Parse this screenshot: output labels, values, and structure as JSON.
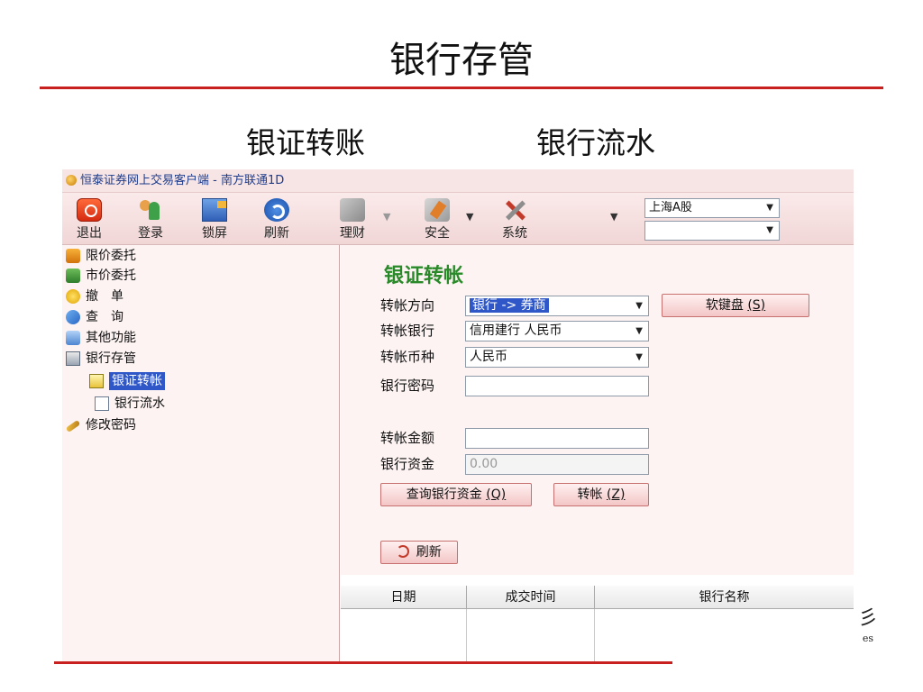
{
  "slide": {
    "title": "银行存管",
    "subtitle_left": "银证转账",
    "subtitle_right": "银行流水",
    "corner_glyph": "彡",
    "corner_text": "es"
  },
  "window": {
    "title": "恒泰证券网上交易客户端 - 南方联通1D"
  },
  "toolbar": {
    "exit": "退出",
    "login": "登录",
    "lock": "锁屏",
    "refresh": "刷新",
    "finance": "理财",
    "safety": "安全",
    "system": "系统",
    "market_select": "上海A股",
    "market_select2": ""
  },
  "sidebar": {
    "items": [
      {
        "label": "限价委托"
      },
      {
        "label": "市价委托"
      },
      {
        "label": "撤　单"
      },
      {
        "label": "查　询"
      },
      {
        "label": "其他功能"
      },
      {
        "label": "银行存管"
      },
      {
        "label": "银证转帐"
      },
      {
        "label": "银行流水"
      },
      {
        "label": "修改密码"
      }
    ]
  },
  "form": {
    "title": "银证转帐",
    "direction_label": "转帐方向",
    "direction_value": "银行 -> 券商",
    "keyboard_button": "软键盘",
    "keyboard_hotkey": "(S)",
    "bank_label": "转帐银行",
    "bank_value": "信用建行 人民币",
    "currency_label": "转帐币种",
    "currency_value": "人民币",
    "password_label": "银行密码",
    "password_value": "",
    "amount_label": "转帐金额",
    "amount_value": "",
    "funds_label": "银行资金",
    "funds_value": "0.00",
    "query_button": "查询银行资金",
    "query_hotkey": "(Q)",
    "transfer_button": "转帐",
    "transfer_hotkey": "(Z)",
    "refresh_button": "刷新"
  },
  "table": {
    "columns": [
      "日期",
      "成交时间",
      "银行名称"
    ]
  },
  "colors": {
    "rule_red": "#c8201e",
    "form_title_green": "#2a8a2a",
    "selection_blue": "#2f57c8"
  }
}
